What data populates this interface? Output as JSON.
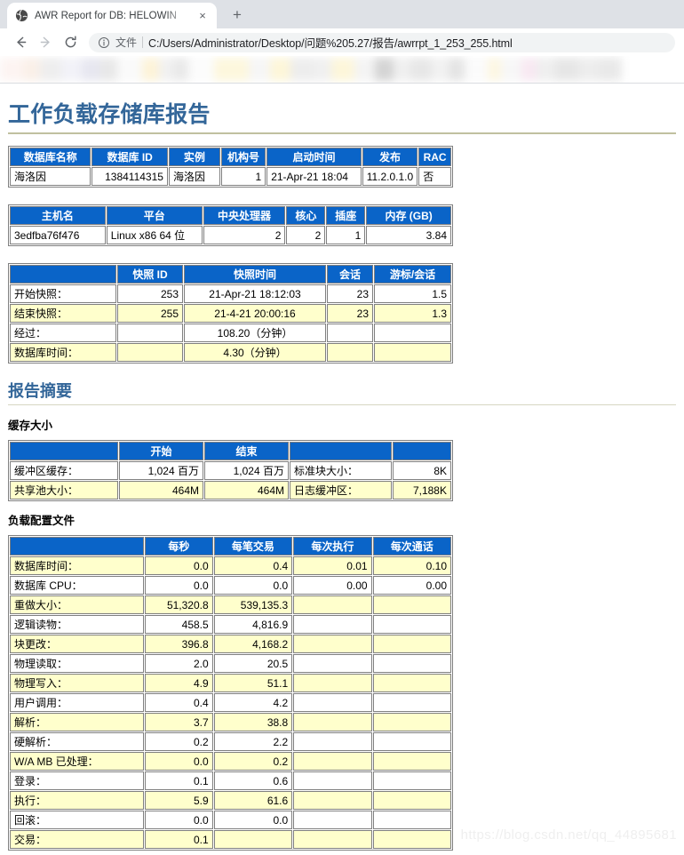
{
  "browser": {
    "tab": {
      "title": "AWR Report for DB: HELOWIN",
      "favicon": "globe-icon",
      "close": "×"
    },
    "new_tab": "+",
    "nav": {
      "back": "←",
      "forward": "→",
      "reload": "↻"
    },
    "omnibox": {
      "info_icon": "info-circle-icon",
      "scheme_label": "文件",
      "url": "C:/Users/Administrator/Desktop/问题%205.27/报告/awrrpt_1_253_255.html"
    }
  },
  "colors": {
    "heading": "#336699",
    "table_header_bg": "#0A64C8",
    "alt_row_bg": "#FFFFCC",
    "border": "#808080"
  },
  "report": {
    "title": "工作负载存储库报告",
    "summary_heading": "报告摘要",
    "cache_heading": "缓存大小",
    "workload_heading": "负载配置文件"
  },
  "db_table": {
    "headers": [
      "数据库名称",
      "数据库 ID",
      "实例",
      "机构号",
      "启动时间",
      "发布",
      "RAC"
    ],
    "row": [
      "海洛因",
      "1384114315",
      "海洛因",
      "1",
      "21-Apr-21 18:04",
      "11.2.0.1.0",
      "否"
    ]
  },
  "host_table": {
    "headers": [
      "主机名",
      "平台",
      "中央处理器",
      "核心",
      "插座",
      "内存 (GB)"
    ],
    "row": [
      "3edfba76f476",
      "Linux x86 64 位",
      "2",
      "2",
      "1",
      "3.84"
    ]
  },
  "snap_table": {
    "headers": [
      "",
      "快照 ID",
      "快照时间",
      "会话",
      "游标/会话"
    ],
    "rows": [
      {
        "label": "开始快照：",
        "id": "253",
        "time": "21-Apr-21 18:12:03",
        "sessions": "23",
        "cursors": "1.5"
      },
      {
        "label": "结束快照：",
        "id": "255",
        "time": "21-4-21 20:00:16",
        "sessions": "23",
        "cursors": "1.3"
      },
      {
        "label": "经过：",
        "id": "",
        "time": "108.20（分钟）",
        "sessions": "",
        "cursors": ""
      },
      {
        "label": "数据库时间：",
        "id": "",
        "time": "4.30（分钟）",
        "sessions": "",
        "cursors": ""
      }
    ]
  },
  "cache_table": {
    "headers": [
      "",
      "开始",
      "结束",
      "",
      ""
    ],
    "rows": [
      {
        "label": "缓冲区缓存：",
        "begin": "1,024 百万",
        "end": "1,024 百万",
        "label2": "标准块大小：",
        "value2": "8K"
      },
      {
        "label": "共享池大小：",
        "begin": "464M",
        "end": "464M",
        "label2": "日志缓冲区：",
        "value2": "7,188K"
      }
    ]
  },
  "workload_table": {
    "headers": [
      "",
      "每秒",
      "每笔交易",
      "每次执行",
      "每次通话"
    ],
    "rows": [
      {
        "label": "数据库时间：",
        "per_second": "0.0",
        "per_txn": "0.4",
        "per_exec": "0.01",
        "per_call": "0.10"
      },
      {
        "label": "数据库 CPU：",
        "per_second": "0.0",
        "per_txn": "0.0",
        "per_exec": "0.00",
        "per_call": "0.00"
      },
      {
        "label": "重做大小：",
        "per_second": "51,320.8",
        "per_txn": "539,135.3",
        "per_exec": "",
        "per_call": ""
      },
      {
        "label": "逻辑读物：",
        "per_second": "458.5",
        "per_txn": "4,816.9",
        "per_exec": "",
        "per_call": ""
      },
      {
        "label": "块更改：",
        "per_second": "396.8",
        "per_txn": "4,168.2",
        "per_exec": "",
        "per_call": ""
      },
      {
        "label": "物理读取：",
        "per_second": "2.0",
        "per_txn": "20.5",
        "per_exec": "",
        "per_call": ""
      },
      {
        "label": "物理写入：",
        "per_second": "4.9",
        "per_txn": "51.1",
        "per_exec": "",
        "per_call": ""
      },
      {
        "label": "用户调用：",
        "per_second": "0.4",
        "per_txn": "4.2",
        "per_exec": "",
        "per_call": ""
      },
      {
        "label": "解析：",
        "per_second": "3.7",
        "per_txn": "38.8",
        "per_exec": "",
        "per_call": ""
      },
      {
        "label": "硬解析：",
        "per_second": "0.2",
        "per_txn": "2.2",
        "per_exec": "",
        "per_call": ""
      },
      {
        "label": "W/A MB 已处理：",
        "per_second": "0.0",
        "per_txn": "0.2",
        "per_exec": "",
        "per_call": ""
      },
      {
        "label": "登录：",
        "per_second": "0.1",
        "per_txn": "0.6",
        "per_exec": "",
        "per_call": ""
      },
      {
        "label": "执行：",
        "per_second": "5.9",
        "per_txn": "61.6",
        "per_exec": "",
        "per_call": ""
      },
      {
        "label": "回滚：",
        "per_second": "0.0",
        "per_txn": "0.0",
        "per_exec": "",
        "per_call": ""
      },
      {
        "label": "交易：",
        "per_second": "0.1",
        "per_txn": "",
        "per_exec": "",
        "per_call": ""
      }
    ]
  },
  "watermark": "https://blog.csdn.net/qq_44895681"
}
